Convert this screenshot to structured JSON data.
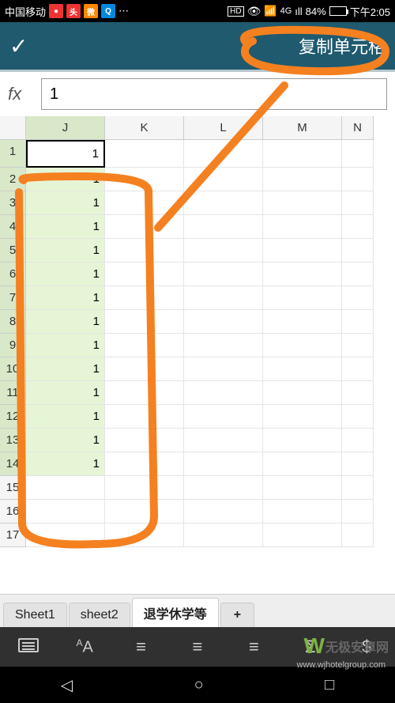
{
  "status_bar": {
    "carrier": "中国移动",
    "hd": "HD",
    "net": "4G",
    "signal": "ıll",
    "battery": "84%",
    "clock": "下午2:05"
  },
  "header": {
    "option": "复制单元格"
  },
  "formula": {
    "fx": "fx",
    "value": "1"
  },
  "columns": [
    "J",
    "K",
    "L",
    "M",
    "N"
  ],
  "rows": [
    {
      "num": "1",
      "val": "1",
      "active": true,
      "sel": false
    },
    {
      "num": "2",
      "val": "1",
      "sel": true
    },
    {
      "num": "3",
      "val": "1",
      "sel": true
    },
    {
      "num": "4",
      "val": "1",
      "sel": true
    },
    {
      "num": "5",
      "val": "1",
      "sel": true
    },
    {
      "num": "6",
      "val": "1",
      "sel": true
    },
    {
      "num": "7",
      "val": "1",
      "sel": true
    },
    {
      "num": "8",
      "val": "1",
      "sel": true
    },
    {
      "num": "9",
      "val": "1",
      "sel": true
    },
    {
      "num": "10",
      "val": "1",
      "sel": true
    },
    {
      "num": "11",
      "val": "1",
      "sel": true
    },
    {
      "num": "12",
      "val": "1",
      "sel": true
    },
    {
      "num": "13",
      "val": "1",
      "sel": true
    },
    {
      "num": "14",
      "val": "1",
      "sel": true
    },
    {
      "num": "15",
      "val": "",
      "sel": false
    },
    {
      "num": "16",
      "val": "",
      "sel": false
    },
    {
      "num": "17",
      "val": "",
      "sel": false
    }
  ],
  "tabs": {
    "items": [
      "Sheet1",
      "sheet2",
      "退学休学等"
    ],
    "active": 2,
    "add": "+"
  },
  "toolbar": {
    "sum": "Σ",
    "currency": "$"
  },
  "watermark": {
    "text": "无极安卓网",
    "url": "www.wjhotelgroup.com"
  }
}
